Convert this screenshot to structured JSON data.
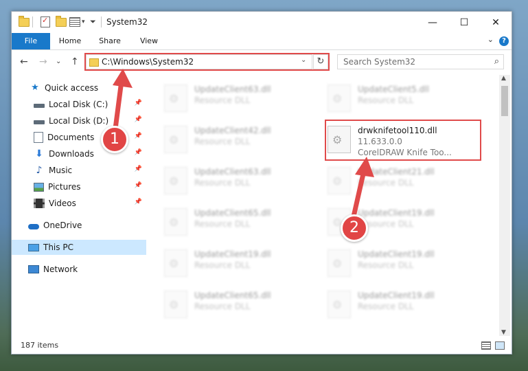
{
  "window": {
    "title": "System32",
    "minimize_glyph": "—",
    "maximize_glyph": "☐",
    "close_glyph": "✕"
  },
  "ribbon": {
    "tabs": [
      "File",
      "Home",
      "Share",
      "View"
    ],
    "help_glyph": "?",
    "collapse_glyph": "⌄"
  },
  "navigation": {
    "back_glyph": "←",
    "forward_glyph": "→",
    "recent_glyph": "⌄",
    "up_glyph": "↑",
    "address_path": "C:\\Windows\\System32",
    "address_dropdown_glyph": "⌄",
    "refresh_glyph": "↻",
    "search_placeholder": "Search System32",
    "search_glyph": "⌕"
  },
  "sidebar": {
    "items": [
      {
        "label": "Quick access"
      },
      {
        "label": "Local Disk (C:)"
      },
      {
        "label": "Local Disk (D:)"
      },
      {
        "label": "Documents"
      },
      {
        "label": "Downloads"
      },
      {
        "label": "Music"
      },
      {
        "label": "Pictures"
      },
      {
        "label": "Videos"
      },
      {
        "label": "OneDrive"
      },
      {
        "label": "This PC"
      },
      {
        "label": "Network"
      }
    ],
    "pin_glyph": "📌"
  },
  "files": [
    {
      "name": "UpdateClient63.dll",
      "sub1": "Resource DLL",
      "sub2": ""
    },
    {
      "name": "UpdateClient5.dll",
      "sub1": "Resource DLL",
      "sub2": ""
    },
    {
      "name": "UpdateClient42.dll",
      "sub1": "Resource DLL",
      "sub2": ""
    },
    {
      "name": "drwknifetool110.dll",
      "sub1": "11.633.0.0",
      "sub2": "CorelDRAW Knife Too..."
    },
    {
      "name": "UpdateClient63.dll",
      "sub1": "Resource DLL",
      "sub2": ""
    },
    {
      "name": "UpdateClient21.dll",
      "sub1": "Resource DLL",
      "sub2": ""
    },
    {
      "name": "UpdateClient65.dll",
      "sub1": "Resource DLL",
      "sub2": ""
    },
    {
      "name": "UpdateClient19.dll",
      "sub1": "Resource DLL",
      "sub2": ""
    },
    {
      "name": "UpdateClient19.dll",
      "sub1": "Resource DLL",
      "sub2": ""
    },
    {
      "name": "UpdateClient19.dll",
      "sub1": "Resource DLL",
      "sub2": ""
    },
    {
      "name": "UpdateClient65.dll",
      "sub1": "Resource DLL",
      "sub2": ""
    },
    {
      "name": "UpdateClient19.dll",
      "sub1": "Resource DLL",
      "sub2": ""
    }
  ],
  "status": {
    "item_count": "187 items"
  },
  "annotations": {
    "callout_1": "1",
    "callout_2": "2",
    "color": "#e04a4a"
  },
  "scrollbar": {
    "up_glyph": "▲",
    "down_glyph": "▼"
  }
}
